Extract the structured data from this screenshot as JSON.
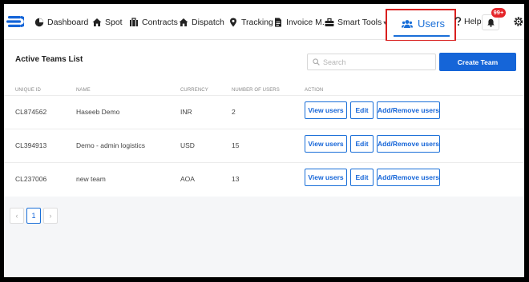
{
  "navbar": {
    "items": [
      {
        "label": "Dashboard",
        "icon": "dashboard-icon"
      },
      {
        "label": "Spot",
        "icon": "home-icon"
      },
      {
        "label": "Contracts",
        "icon": "contracts-icon"
      },
      {
        "label": "Dispatch",
        "icon": "dispatch-icon"
      },
      {
        "label": "Tracking",
        "icon": "location-pin-icon"
      },
      {
        "label": "Invoice M.",
        "icon": "invoice-icon"
      },
      {
        "label": "Smart Tools",
        "icon": "toolbox-icon",
        "has_dropdown": true
      }
    ],
    "active_tab": {
      "label": "Users",
      "icon": "users-icon"
    },
    "help_label": "Help",
    "notification_count": "99+",
    "accent_color": "#1565d8",
    "highlight_color": "#d9201f"
  },
  "main": {
    "title": "Active Teams List",
    "search": {
      "placeholder": "Search",
      "value": ""
    },
    "create_button": "Create Team",
    "columns": [
      "UNIQUE ID",
      "NAME",
      "CURRENCY",
      "NUMBER OF USERS",
      "ACTION"
    ],
    "rows": [
      {
        "id": "CL874562",
        "name": "Haseeb Demo",
        "currency": "INR",
        "users": "2"
      },
      {
        "id": "CL394913",
        "name": "Demo - admin logistics",
        "currency": "USD",
        "users": "15"
      },
      {
        "id": "CL237006",
        "name": "new team",
        "currency": "AOA",
        "users": "13"
      }
    ],
    "actions": {
      "view": "View users",
      "edit": "Edit",
      "add_remove": "Add/Remove users"
    }
  },
  "pagination": {
    "prev": "‹",
    "current": "1",
    "next": "›"
  }
}
